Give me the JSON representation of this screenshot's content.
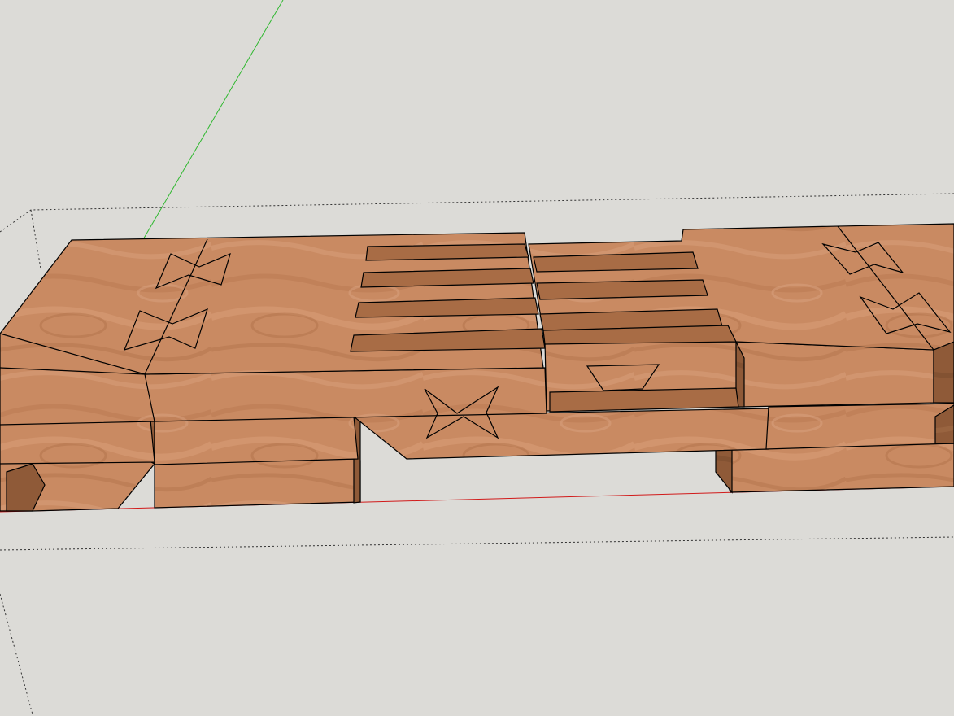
{
  "viewport": {
    "background": "#dcdbd7"
  },
  "axes": {
    "green_axis_color": "#2fb82f",
    "red_axis_color": "#d11a1a"
  },
  "model": {
    "material": "wood-texture",
    "top_color": "#c98a62",
    "front_color": "#c78660",
    "side_color": "#8f5a38",
    "slot_color": "#a86c45",
    "edge_color": "#000000"
  }
}
